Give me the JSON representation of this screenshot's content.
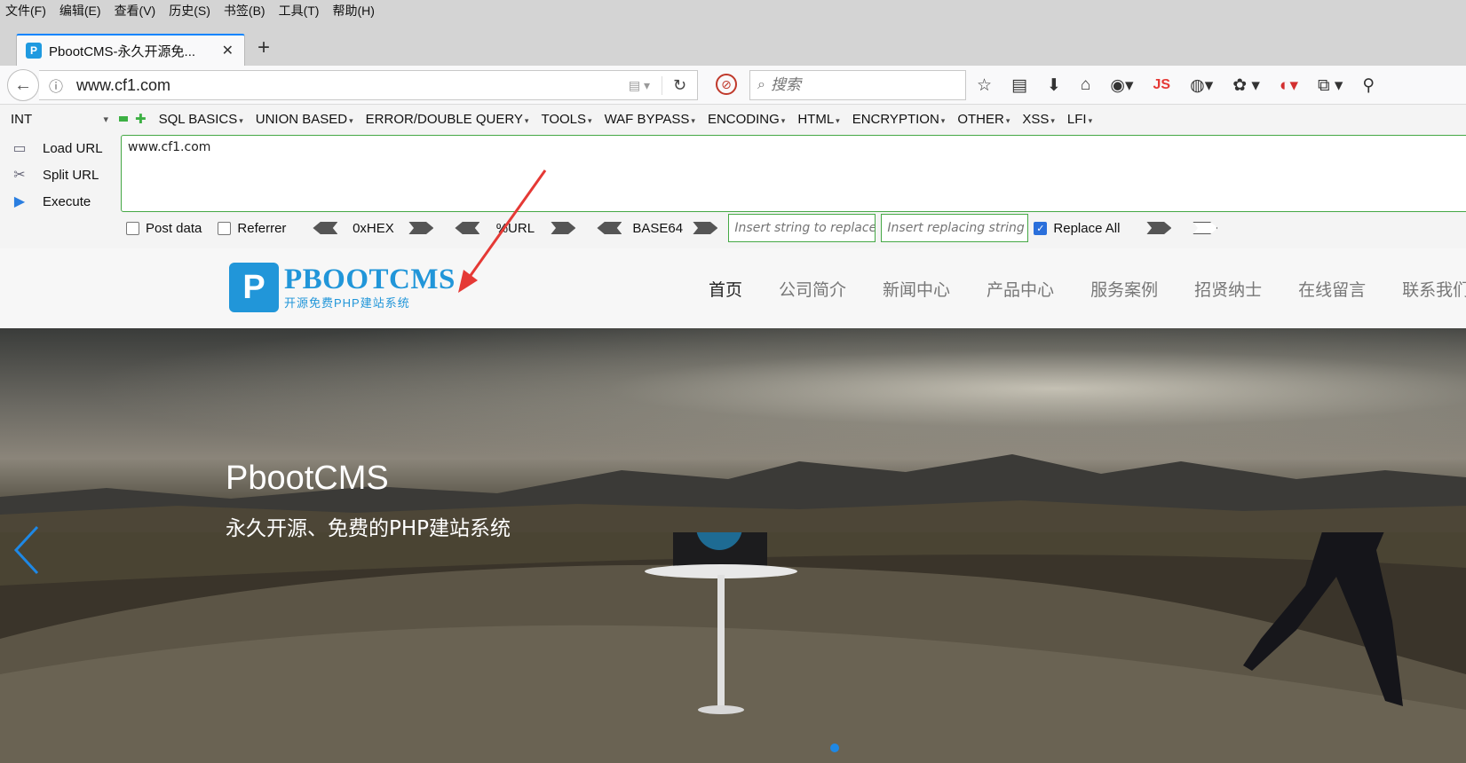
{
  "menubar": {
    "items": [
      "文件(F)",
      "编辑(E)",
      "查看(V)",
      "历史(S)",
      "书签(B)",
      "工具(T)",
      "帮助(H)"
    ]
  },
  "tab": {
    "favicon": "P",
    "title": "PbootCMS-永久开源免...",
    "close": "✕",
    "new": "+"
  },
  "navbar": {
    "back": "←",
    "info": "ⓘ",
    "url": "www.cf1.com",
    "reload": "↻",
    "search_placeholder": "搜索",
    "js_label": "JS",
    "icons": [
      "star-icon",
      "reading-list-icon",
      "download-icon",
      "home-icon",
      "globe-icon",
      "js-icon",
      "chrome-icon",
      "palette-icon",
      "capture-icon",
      "share-icon",
      "zoom-icon"
    ]
  },
  "hackbar": {
    "select": "INT",
    "menu": [
      "SQL BASICS",
      "UNION BASED",
      "ERROR/DOUBLE QUERY",
      "TOOLS",
      "WAF BYPASS",
      "ENCODING",
      "HTML",
      "ENCRYPTION",
      "OTHER",
      "XSS",
      "LFI"
    ],
    "load_url": "Load URL",
    "split_url": "Split URL",
    "execute": "Execute",
    "url_value": "www.cf1.com",
    "post_data": "Post data",
    "referrer": "Referrer",
    "hex": "0xHEX",
    "url_enc": "%URL",
    "base64": "BASE64",
    "find_placeholder": "Insert string to replace",
    "replace_placeholder": "Insert replacing string",
    "replace_all": "Replace All",
    "replace_all_checked": true
  },
  "site": {
    "logo_title": "PBOOTCMS",
    "logo_sub": "开源免费PHP建站系统",
    "nav": [
      "首页",
      "公司简介",
      "新闻中心",
      "产品中心",
      "服务案例",
      "招贤纳士",
      "在线留言",
      "联系我们"
    ],
    "active_nav": "首页",
    "hero_title": "PbootCMS",
    "hero_sub": "永久开源、免费的PHP建站系统"
  },
  "colors": {
    "accent": "#2196d9",
    "hackbar_border": "#45a845",
    "annotation": "#e53935",
    "carousel_dot": "#1e88e5"
  }
}
